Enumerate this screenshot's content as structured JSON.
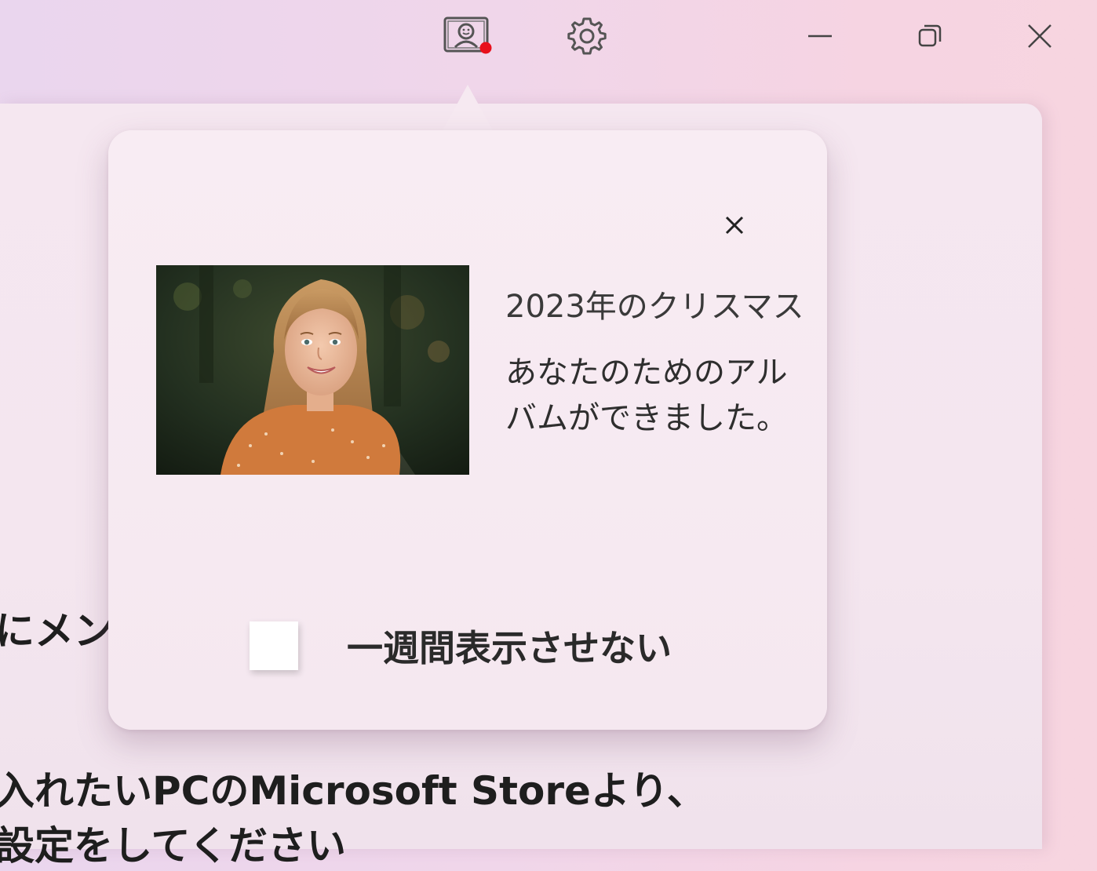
{
  "titlebar": {
    "icons": {
      "memories": "photo-memories-icon",
      "settings": "gear-icon",
      "minimize": "minimize-icon",
      "maximize": "restore-icon",
      "close": "close-icon"
    },
    "notification_dot_color": "#e8101c"
  },
  "background": {
    "line1": "にメンバ",
    "line2": "入れたいPCのMicrosoft Storeより、",
    "line3": "設定をしてください"
  },
  "popup": {
    "title": "2023年のクリスマス",
    "description": "あなたのためのアルバムができました。",
    "checkbox_label": "一週間表示させない",
    "checkbox_checked": false,
    "close_icon": "close-icon"
  }
}
